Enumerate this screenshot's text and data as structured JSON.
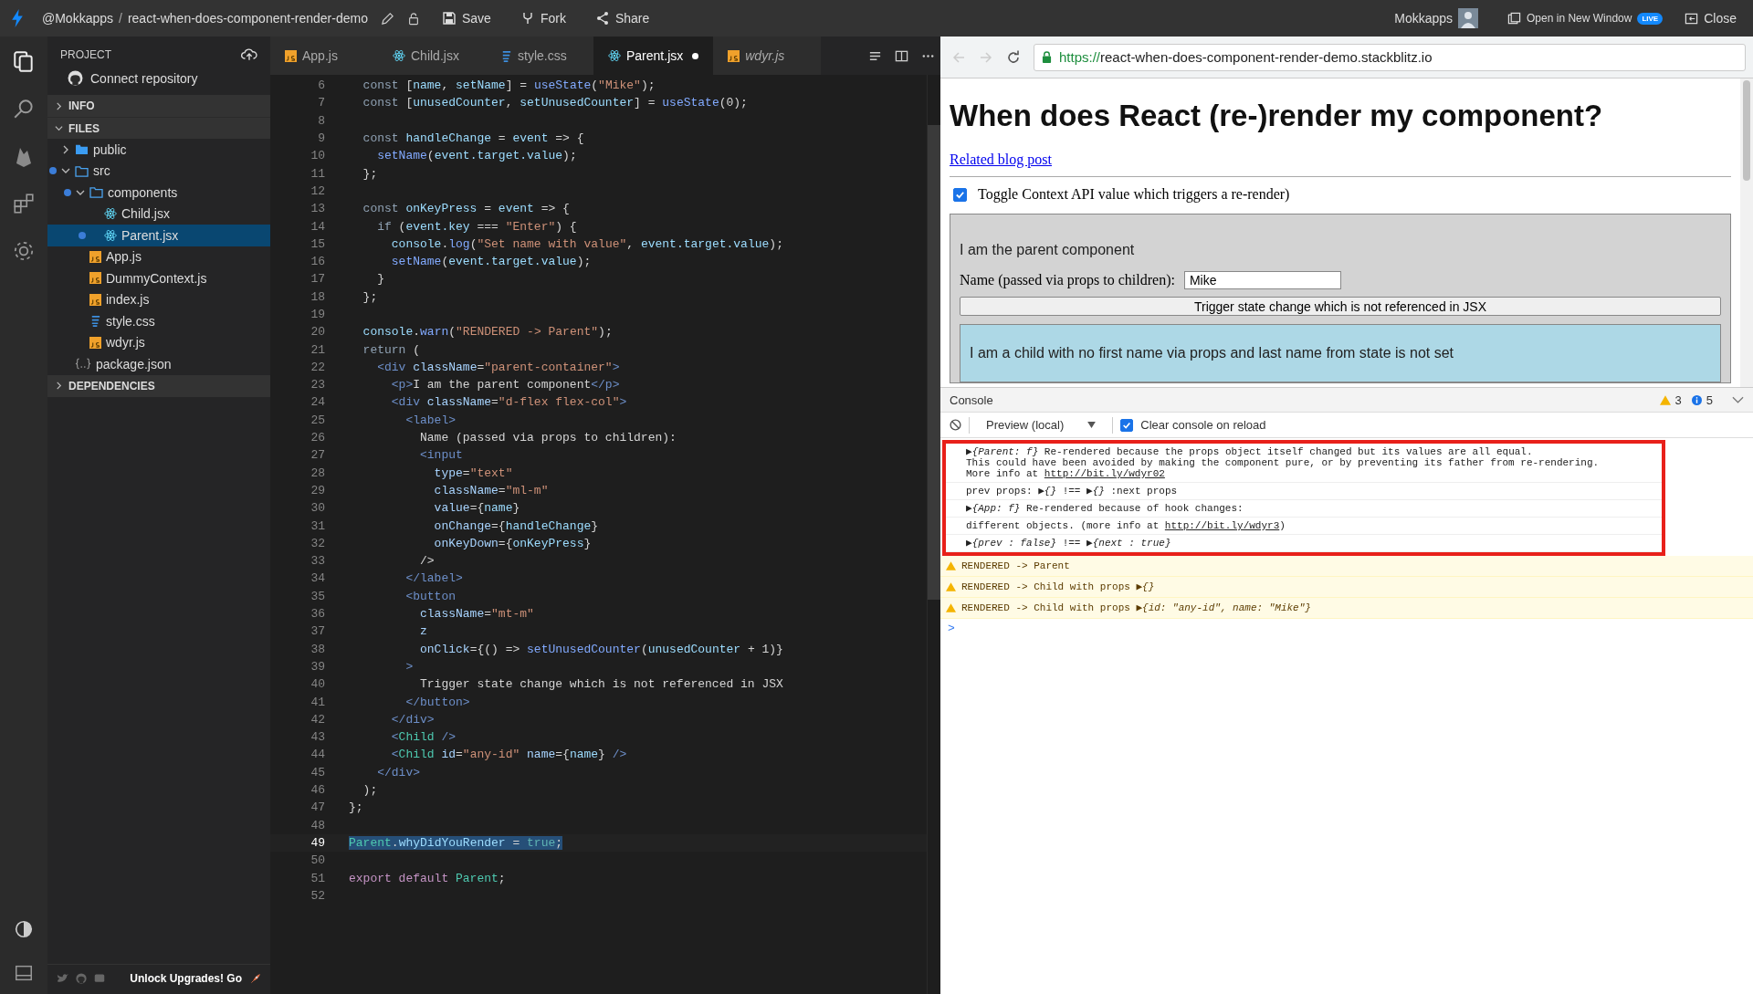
{
  "topbar": {
    "owner": "@Mokkapps",
    "separator": "/",
    "project": "react-when-does-component-render-demo",
    "actions": [
      {
        "kind": "save",
        "label": "Save"
      },
      {
        "kind": "fork",
        "label": "Fork"
      },
      {
        "kind": "share",
        "label": "Share"
      }
    ],
    "user": "Mokkapps",
    "open_window": "Open in New Window",
    "live_badge": "LIVE",
    "close": "Close"
  },
  "sidebar": {
    "title": "PROJECT",
    "connect": "Connect repository",
    "sections": [
      {
        "label": "INFO",
        "expanded": false
      },
      {
        "label": "FILES",
        "expanded": true
      }
    ],
    "tree": [
      {
        "name": "public",
        "kind": "folder",
        "expanded": false,
        "modified": false,
        "selected": false
      },
      {
        "name": "src",
        "kind": "folder",
        "expanded": true,
        "modified": true,
        "selected": false,
        "children": [
          {
            "name": "components",
            "kind": "folder",
            "expanded": true,
            "modified": true,
            "selected": false,
            "children": [
              {
                "name": "Child.jsx",
                "kind": "react",
                "modified": false,
                "selected": false
              },
              {
                "name": "Parent.jsx",
                "kind": "react",
                "modified": true,
                "selected": true
              }
            ]
          },
          {
            "name": "App.js",
            "kind": "js",
            "modified": false,
            "selected": false
          },
          {
            "name": "DummyContext.js",
            "kind": "js",
            "modified": false,
            "selected": false
          },
          {
            "name": "index.js",
            "kind": "js",
            "modified": false,
            "selected": false
          },
          {
            "name": "style.css",
            "kind": "css",
            "modified": false,
            "selected": false
          },
          {
            "name": "wdyr.js",
            "kind": "js",
            "modified": false,
            "selected": false
          }
        ]
      },
      {
        "name": "package.json",
        "kind": "json",
        "modified": false,
        "selected": false
      }
    ],
    "dependencies": {
      "label": "DEPENDENCIES",
      "expanded": false
    },
    "promo": "Unlock Upgrades! Go"
  },
  "tabs": [
    {
      "label": "App.js",
      "kind": "js",
      "selected": false,
      "modified": false,
      "preview": false
    },
    {
      "label": "Child.jsx",
      "kind": "react",
      "selected": false,
      "modified": false,
      "preview": false
    },
    {
      "label": "style.css",
      "kind": "css",
      "selected": false,
      "modified": false,
      "preview": false
    },
    {
      "label": "Parent.jsx",
      "kind": "react",
      "selected": true,
      "modified": true,
      "preview": false
    },
    {
      "label": "wdyr.js",
      "kind": "js",
      "selected": false,
      "modified": false,
      "preview": true
    }
  ],
  "code": [
    {
      "n": "6",
      "selected": false,
      "tokens": [
        {
          "kind": "kw",
          "text": "  const"
        },
        {
          "kind": "p",
          "text": " ["
        },
        {
          "kind": "v",
          "text": "name"
        },
        {
          "kind": "p",
          "text": ", "
        },
        {
          "kind": "v",
          "text": "setName"
        },
        {
          "kind": "p",
          "text": "] = "
        },
        {
          "kind": "fn",
          "text": "useState"
        },
        {
          "kind": "p",
          "text": "("
        },
        {
          "kind": "s",
          "text": "\"Mike\""
        },
        {
          "kind": "p",
          "text": ");"
        }
      ]
    },
    {
      "n": "7",
      "selected": false,
      "tokens": [
        {
          "kind": "kw",
          "text": "  const"
        },
        {
          "kind": "p",
          "text": " ["
        },
        {
          "kind": "v",
          "text": "unusedCounter"
        },
        {
          "kind": "p",
          "text": ", "
        },
        {
          "kind": "v",
          "text": "setUnusedCounter"
        },
        {
          "kind": "p",
          "text": "] = "
        },
        {
          "kind": "fn",
          "text": "useState"
        },
        {
          "kind": "p",
          "text": "(0);"
        }
      ]
    },
    {
      "n": "8",
      "selected": false
    },
    {
      "n": "9",
      "selected": false,
      "tokens": [
        {
          "kind": "kw",
          "text": "  const"
        },
        {
          "kind": "v",
          "text": " handleChange"
        },
        {
          "kind": "p",
          "text": " = "
        },
        {
          "kind": "v",
          "text": "event"
        },
        {
          "kind": "p",
          "text": " => {"
        }
      ]
    },
    {
      "n": "10",
      "selected": false,
      "tokens": [
        {
          "kind": "fn",
          "text": "    setName"
        },
        {
          "kind": "p",
          "text": "("
        },
        {
          "kind": "v",
          "text": "event.target.value"
        },
        {
          "kind": "p",
          "text": ");"
        }
      ]
    },
    {
      "n": "11",
      "selected": false,
      "tokens": [
        {
          "kind": "p",
          "text": "  };"
        }
      ]
    },
    {
      "n": "12",
      "selected": false
    },
    {
      "n": "13",
      "selected": false,
      "tokens": [
        {
          "kind": "kw",
          "text": "  const"
        },
        {
          "kind": "v",
          "text": " onKeyPress"
        },
        {
          "kind": "p",
          "text": " = "
        },
        {
          "kind": "v",
          "text": "event"
        },
        {
          "kind": "p",
          "text": " => {"
        }
      ]
    },
    {
      "n": "14",
      "selected": false,
      "tokens": [
        {
          "kind": "kw",
          "text": "    if"
        },
        {
          "kind": "p",
          "text": " ("
        },
        {
          "kind": "v",
          "text": "event.key"
        },
        {
          "kind": "p",
          "text": " === "
        },
        {
          "kind": "s",
          "text": "\"Enter\""
        },
        {
          "kind": "p",
          "text": ") {"
        }
      ]
    },
    {
      "n": "15",
      "selected": false,
      "tokens": [
        {
          "kind": "v",
          "text": "      console"
        },
        {
          "kind": "p",
          "text": "."
        },
        {
          "kind": "fn",
          "text": "log"
        },
        {
          "kind": "p",
          "text": "("
        },
        {
          "kind": "s",
          "text": "\"Set name with value\""
        },
        {
          "kind": "p",
          "text": ", "
        },
        {
          "kind": "v",
          "text": "event.target.value"
        },
        {
          "kind": "p",
          "text": ");"
        }
      ]
    },
    {
      "n": "16",
      "selected": false,
      "tokens": [
        {
          "kind": "fn",
          "text": "      setName"
        },
        {
          "kind": "p",
          "text": "("
        },
        {
          "kind": "v",
          "text": "event.target.value"
        },
        {
          "kind": "p",
          "text": ");"
        }
      ]
    },
    {
      "n": "17",
      "selected": false,
      "tokens": [
        {
          "kind": "p",
          "text": "    }"
        }
      ]
    },
    {
      "n": "18",
      "selected": false,
      "tokens": [
        {
          "kind": "p",
          "text": "  };"
        }
      ]
    },
    {
      "n": "19",
      "selected": false
    },
    {
      "n": "20",
      "selected": false,
      "tokens": [
        {
          "kind": "v",
          "text": "  console"
        },
        {
          "kind": "p",
          "text": "."
        },
        {
          "kind": "fn",
          "text": "warn"
        },
        {
          "kind": "p",
          "text": "("
        },
        {
          "kind": "s",
          "text": "\"RENDERED -> Parent\""
        },
        {
          "kind": "p",
          "text": ");"
        }
      ]
    },
    {
      "n": "21",
      "selected": false,
      "tokens": [
        {
          "kind": "kw",
          "text": "  return"
        },
        {
          "kind": "p",
          "text": " ("
        }
      ]
    },
    {
      "n": "22",
      "selected": false,
      "tokens": [
        {
          "kind": "t",
          "text": "    <div"
        },
        {
          "kind": "a",
          "text": " className"
        },
        {
          "kind": "p",
          "text": "="
        },
        {
          "kind": "s",
          "text": "\"parent-container\""
        },
        {
          "kind": "t",
          "text": ">"
        }
      ]
    },
    {
      "n": "23",
      "selected": false,
      "tokens": [
        {
          "kind": "t",
          "text": "      <p>"
        },
        {
          "kind": "p",
          "text": "I am the parent component"
        },
        {
          "kind": "t",
          "text": "</p>"
        }
      ]
    },
    {
      "n": "24",
      "selected": false,
      "tokens": [
        {
          "kind": "t",
          "text": "      <div"
        },
        {
          "kind": "a",
          "text": " className"
        },
        {
          "kind": "p",
          "text": "="
        },
        {
          "kind": "s",
          "text": "\"d-flex flex-col\""
        },
        {
          "kind": "t",
          "text": ">"
        }
      ]
    },
    {
      "n": "25",
      "selected": false,
      "tokens": [
        {
          "kind": "t",
          "text": "        <label>"
        }
      ]
    },
    {
      "n": "26",
      "selected": false,
      "tokens": [
        {
          "kind": "p",
          "text": "          Name (passed via props to children):"
        }
      ]
    },
    {
      "n": "27",
      "selected": false,
      "tokens": [
        {
          "kind": "t",
          "text": "          <input"
        }
      ]
    },
    {
      "n": "28",
      "selected": false,
      "tokens": [
        {
          "kind": "a",
          "text": "            type"
        },
        {
          "kind": "p",
          "text": "="
        },
        {
          "kind": "s",
          "text": "\"text\""
        }
      ]
    },
    {
      "n": "29",
      "selected": false,
      "tokens": [
        {
          "kind": "a",
          "text": "            className"
        },
        {
          "kind": "p",
          "text": "="
        },
        {
          "kind": "s",
          "text": "\"ml-m\""
        }
      ]
    },
    {
      "n": "30",
      "selected": false,
      "tokens": [
        {
          "kind": "a",
          "text": "            value"
        },
        {
          "kind": "p",
          "text": "={"
        },
        {
          "kind": "v",
          "text": "name"
        },
        {
          "kind": "p",
          "text": "}"
        }
      ]
    },
    {
      "n": "31",
      "selected": false,
      "tokens": [
        {
          "kind": "a",
          "text": "            onChange"
        },
        {
          "kind": "p",
          "text": "={"
        },
        {
          "kind": "v",
          "text": "handleChange"
        },
        {
          "kind": "p",
          "text": "}"
        }
      ]
    },
    {
      "n": "32",
      "selected": false,
      "tokens": [
        {
          "kind": "a",
          "text": "            onKeyDown"
        },
        {
          "kind": "p",
          "text": "={"
        },
        {
          "kind": "v",
          "text": "onKeyPress"
        },
        {
          "kind": "p",
          "text": "}"
        }
      ]
    },
    {
      "n": "33",
      "selected": false,
      "tokens": [
        {
          "kind": "p",
          "text": "          />"
        }
      ]
    },
    {
      "n": "34",
      "selected": false,
      "tokens": [
        {
          "kind": "t",
          "text": "        </label>"
        }
      ]
    },
    {
      "n": "35",
      "selected": false,
      "tokens": [
        {
          "kind": "t",
          "text": "        <button"
        }
      ]
    },
    {
      "n": "36",
      "selected": false,
      "tokens": [
        {
          "kind": "a",
          "text": "          className"
        },
        {
          "kind": "p",
          "text": "="
        },
        {
          "kind": "s",
          "text": "\"mt-m\""
        }
      ]
    },
    {
      "n": "37",
      "selected": false,
      "tokens": [
        {
          "kind": "a",
          "text": "          z"
        }
      ]
    },
    {
      "n": "38",
      "selected": false,
      "tokens": [
        {
          "kind": "a",
          "text": "          onClick"
        },
        {
          "kind": "p",
          "text": "={() => "
        },
        {
          "kind": "fn",
          "text": "setUnusedCounter"
        },
        {
          "kind": "p",
          "text": "("
        },
        {
          "kind": "v",
          "text": "unusedCounter"
        },
        {
          "kind": "p",
          "text": " + 1)}"
        }
      ]
    },
    {
      "n": "39",
      "selected": false,
      "tokens": [
        {
          "kind": "t",
          "text": "        >"
        }
      ]
    },
    {
      "n": "40",
      "selected": false,
      "tokens": [
        {
          "kind": "p",
          "text": "          Trigger state change which is not referenced in JSX"
        }
      ]
    },
    {
      "n": "41",
      "selected": false,
      "tokens": [
        {
          "kind": "t",
          "text": "        </button>"
        }
      ]
    },
    {
      "n": "42",
      "selected": false,
      "tokens": [
        {
          "kind": "t",
          "text": "      </div>"
        }
      ]
    },
    {
      "n": "43",
      "selected": false,
      "tokens": [
        {
          "kind": "t",
          "text": "      <"
        },
        {
          "kind": "c",
          "text": "Child"
        },
        {
          "kind": "t",
          "text": " />"
        }
      ]
    },
    {
      "n": "44",
      "selected": false,
      "tokens": [
        {
          "kind": "t",
          "text": "      <"
        },
        {
          "kind": "c",
          "text": "Child"
        },
        {
          "kind": "a",
          "text": " id"
        },
        {
          "kind": "p",
          "text": "="
        },
        {
          "kind": "s",
          "text": "\"any-id\""
        },
        {
          "kind": "a",
          "text": " name"
        },
        {
          "kind": "p",
          "text": "={"
        },
        {
          "kind": "v",
          "text": "name"
        },
        {
          "kind": "p",
          "text": "}"
        },
        {
          "kind": "t",
          "text": " />"
        }
      ]
    },
    {
      "n": "45",
      "selected": false,
      "tokens": [
        {
          "kind": "t",
          "text": "    </div>"
        }
      ]
    },
    {
      "n": "46",
      "selected": false,
      "tokens": [
        {
          "kind": "p",
          "text": "  );"
        }
      ]
    },
    {
      "n": "47",
      "selected": false,
      "tokens": [
        {
          "kind": "p",
          "text": "};"
        }
      ]
    },
    {
      "n": "48",
      "selected": false
    },
    {
      "n": "49",
      "selected": true,
      "tokens": [
        {
          "kind": "c",
          "text": "Parent"
        },
        {
          "kind": "p",
          "text": "."
        },
        {
          "kind": "v",
          "text": "whyDidYouRender"
        },
        {
          "kind": "p",
          "text": " = "
        },
        {
          "kind": "b",
          "text": "true"
        },
        {
          "kind": "p",
          "text": ";"
        }
      ]
    },
    {
      "n": "50",
      "selected": false
    },
    {
      "n": "51",
      "selected": false,
      "tokens": [
        {
          "kind": "x",
          "text": "export default"
        },
        {
          "kind": "c",
          "text": " Parent"
        },
        {
          "kind": "p",
          "text": ";"
        }
      ]
    },
    {
      "n": "52",
      "selected": false
    }
  ],
  "browser": {
    "url_scheme": "https://",
    "url_host": "react-when-does-component-render-demo.stackblitz.io",
    "page": {
      "heading": "When does React (re-)render my component?",
      "link": "Related blog post",
      "toggle": {
        "label": "Toggle Context API value which triggers a re-render)",
        "checked": true
      },
      "parent_text": "I am the parent component",
      "name_label": "Name (passed via props to children):",
      "name_value": "Mike",
      "button": "Trigger state change which is not referenced in JSX",
      "child_text": "I am a child with no first name via props and last name from state is not set"
    },
    "console": {
      "tab": "Console",
      "warnings": "3",
      "infos": "5",
      "context": "Preview (local)",
      "clear_on_reload": {
        "label": "Clear console on reload",
        "checked": true
      },
      "highlighted_entries": [
        {
          "text": "▶*{Parent: f}* Re-rendered because the props object itself changed but its values are all equal.\nThis could have been avoided by making the component pure, or by preventing its father from re-rendering.\nMore info at ",
          "link": "http://bit.ly/wdyr02"
        },
        {
          "text": "prev props: ▶*{}* !== ▶*{}* :next props"
        },
        {
          "text": "▶*{App: f}* Re-rendered because of hook changes:"
        },
        {
          "text": "different objects. (more info at ",
          "link": "http://bit.ly/wdyr3",
          "tail": ")"
        },
        {
          "text": "▶*{prev : false}* !== ▶*{next : true}*"
        }
      ],
      "entries": [
        {
          "kind": "warn",
          "text": "RENDERED -> Parent"
        },
        {
          "kind": "warn",
          "text": "RENDERED -> Child with props ▶*{}*"
        },
        {
          "kind": "warn",
          "text": "RENDERED -> Child with props ▶*{id: \"any-id\", name: \"Mike\"}*"
        }
      ],
      "prompt": ">"
    }
  }
}
